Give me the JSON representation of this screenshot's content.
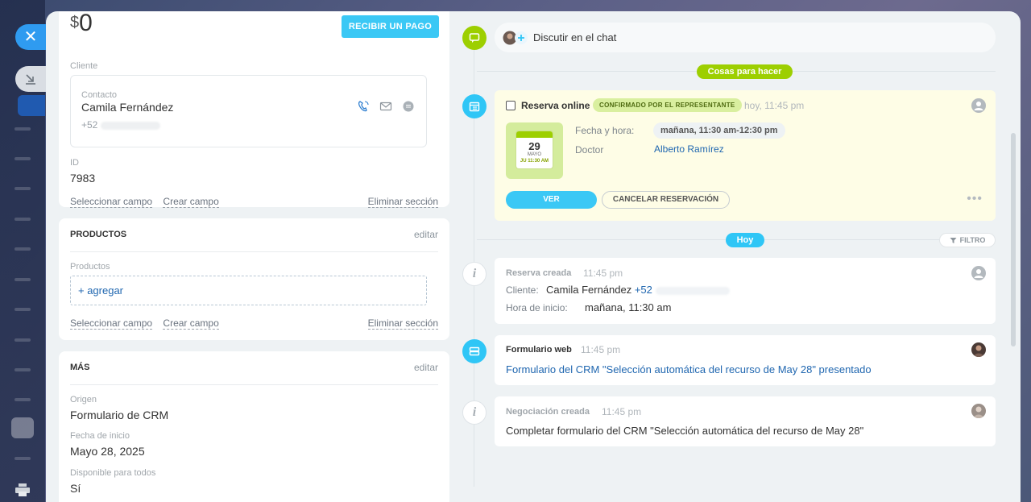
{
  "sidebar": {
    "close_icon": "close-icon",
    "tab_icon": "collapse-icon"
  },
  "deal": {
    "currency": "$",
    "amount": "0",
    "pay_button": "RECIBIR UN PAGO",
    "client_label": "Cliente",
    "contact_label": "Contacto",
    "contact_name": "Camila Fernández",
    "contact_phone": "+52",
    "id_label": "ID",
    "id_value": "7983",
    "select_field": "Seleccionar campo",
    "create_field": "Crear campo",
    "delete_section": "Eliminar sección"
  },
  "products": {
    "title": "PRODUCTOS",
    "edit": "editar",
    "label": "Productos",
    "add": "+ agregar",
    "select_field": "Seleccionar campo",
    "create_field": "Crear campo",
    "delete_section": "Eliminar sección"
  },
  "more": {
    "title": "MÁS",
    "edit": "editar",
    "origin_label": "Origen",
    "origin_value": "Formulario de CRM",
    "start_label": "Fecha de inicio",
    "start_value": "Mayo 28, 2025",
    "available_label": "Disponible para todos",
    "available_value": "Sí"
  },
  "timeline": {
    "chat_text": "Discutir en el chat",
    "todo_pill": "Cosas para hacer",
    "booking": {
      "title": "Reserva online",
      "badge": "CONFIRMADO POR EL REPRESENTANTE",
      "time": "hoy, 11:45 pm",
      "cal_day": "29",
      "cal_month": "MAYO",
      "cal_time": "JU 11:30 AM",
      "date_label": "Fecha y hora:",
      "date_value": "mañana, 11:30 am-12:30 pm",
      "doctor_label": "Doctor",
      "doctor_value": "Alberto Ramírez",
      "view_button": "VER",
      "cancel_button": "CANCELAR RESERVACIÓN"
    },
    "today_pill": "Hoy",
    "filter": "FILTRO",
    "created": {
      "title": "Reserva creada",
      "time": "11:45 pm",
      "client_label": "Cliente:",
      "client_name": "Camila Fernández",
      "client_phone": "+52",
      "start_label": "Hora de inicio:",
      "start_value": "mañana, 11:30 am"
    },
    "webform": {
      "title": "Formulario web",
      "time": "11:45 pm",
      "text": "Formulario del CRM \"Selección automática del recurso de May 28\" presentado"
    },
    "negotiation": {
      "title": "Negociación creada",
      "time": "11:45 pm",
      "text": "Completar formulario del CRM \"Selección automática del recurso de May 28\""
    }
  },
  "colors": {
    "accent_blue": "#3bc8f5",
    "accent_green": "#9dcf00",
    "link": "#2067b0",
    "booking_bg": "#fefde6"
  }
}
